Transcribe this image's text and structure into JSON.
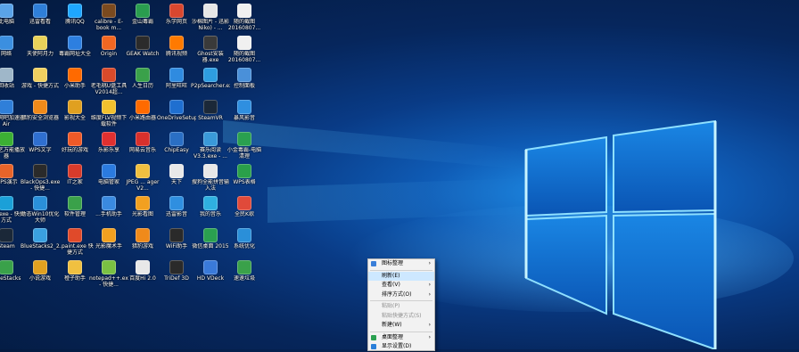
{
  "desktop": {
    "icons": [
      {
        "label": "此电脑",
        "color": "#5aa3e8"
      },
      {
        "label": "迅雷看看",
        "color": "#2f7fd9"
      },
      {
        "label": "腾讯QQ",
        "color": "#1ea7ff"
      },
      {
        "label": "calibre - E-book m...",
        "color": "#7b4a1f"
      },
      {
        "label": "金山毒霸",
        "color": "#2a9d4f"
      },
      {
        "label": "乐学网页",
        "color": "#d9472f"
      },
      {
        "label": "沙棉图片 - 迅影 Niko) - ...",
        "color": "#e6e6e6"
      },
      {
        "label": "随的截图 20160807...",
        "color": "#f0f0f0"
      },
      {
        "label": "网络",
        "color": "#3b8fe0"
      },
      {
        "label": "天使阿月力",
        "color": "#e8d25a"
      },
      {
        "label": "毒霸网址大全",
        "color": "#2d7fe0"
      },
      {
        "label": "Origin",
        "color": "#f26722"
      },
      {
        "label": "GEAK Watch",
        "color": "#2b2b2b"
      },
      {
        "label": "腾讯视频",
        "color": "#ff7a00"
      },
      {
        "label": "Ghost安装器.exe",
        "color": "#3a3a3a"
      },
      {
        "label": "随的截图 20160807...",
        "color": "#f0f0f0"
      },
      {
        "label": "回收站",
        "color": "#9fb7c9"
      },
      {
        "label": "游戏 - 快捷方式",
        "color": "#f0d060"
      },
      {
        "label": "小米助手",
        "color": "#ff6a00"
      },
      {
        "label": "老毛桃U盘工具V2014超...",
        "color": "#d94a2a"
      },
      {
        "label": "人生日历",
        "color": "#3aa14a"
      },
      {
        "label": "阿里旺旺",
        "color": "#2f8be0"
      },
      {
        "label": "P2pSearcher.exe",
        "color": "#2e9de0"
      },
      {
        "label": "控制面板",
        "color": "#4a90d9"
      },
      {
        "label": "迅雷网吧加速器Air",
        "color": "#2f7fd9"
      },
      {
        "label": "猎豹安全浏览器",
        "color": "#f08a1a"
      },
      {
        "label": "影视大全",
        "color": "#e0a020"
      },
      {
        "label": "维度FLV视频下载软件",
        "color": "#f2c12e"
      },
      {
        "label": "小米路由器",
        "color": "#ff6a00"
      },
      {
        "label": "OneDriveSetup.exe",
        "color": "#1f6fd0"
      },
      {
        "label": "SteamVR",
        "color": "#1b2838"
      },
      {
        "label": "暴风影音",
        "color": "#2f8fe0"
      },
      {
        "label": "爱奇艺万能播放器",
        "color": "#3cb034"
      },
      {
        "label": "WPS文字",
        "color": "#2f6fd0"
      },
      {
        "label": "好玩的游戏",
        "color": "#f05a28"
      },
      {
        "label": "乐影乐享",
        "color": "#e03030"
      },
      {
        "label": "网易云音乐",
        "color": "#d8302c"
      },
      {
        "label": "ChipEasy",
        "color": "#2a6fc4"
      },
      {
        "label": "赛乐阅读 V3.3.exe - ...",
        "color": "#3a9ad9"
      },
      {
        "label": "小金毒霸-电脑清理",
        "color": "#2aa050"
      },
      {
        "label": "WPS演示",
        "color": "#e8642a"
      },
      {
        "label": "BlackOps3.exe - 快捷...",
        "color": "#2a2a2a"
      },
      {
        "label": "IT之家",
        "color": "#d83b2b"
      },
      {
        "label": "电脑管家",
        "color": "#2b7be0"
      },
      {
        "label": "JPEG ... ager V2...",
        "color": "#f0c040"
      },
      {
        "label": "天下",
        "color": "#e8e8e8"
      },
      {
        "label": "搜狗全能拼音输入法",
        "color": "#e8e8e8"
      },
      {
        "label": "WPS表格",
        "color": "#2aa04a"
      },
      {
        "label": "Kodiexe - 快捷方式",
        "color": "#1ba0d8"
      },
      {
        "label": "动态Win10优化大师",
        "color": "#2a8fd9"
      },
      {
        "label": "软件管理",
        "color": "#3aa14a"
      },
      {
        "label": "...手机助手",
        "color": "#3a8ae0"
      },
      {
        "label": "光影看图",
        "color": "#f2a020"
      },
      {
        "label": "迅雷影音",
        "color": "#2f8fe0"
      },
      {
        "label": "我的音乐",
        "color": "#2fb0e0"
      },
      {
        "label": "全民K歌",
        "color": "#e04a3a"
      },
      {
        "label": "Steam",
        "color": "#1b2838"
      },
      {
        "label": "BlueStacks2_2.3.35.61...",
        "color": "#3aa0e0"
      },
      {
        "label": "...paint.exe 快捷方式",
        "color": "#e04a2a"
      },
      {
        "label": "光影魔术手",
        "color": "#f2a020"
      },
      {
        "label": "猎豹游戏",
        "color": "#f08a1a"
      },
      {
        "label": "WiFi助手",
        "color": "#2a2a2a"
      },
      {
        "label": "微信桌面 2015",
        "color": "#2aa050"
      },
      {
        "label": "系统优化",
        "color": "#2a8fd9"
      },
      {
        "label": "BlueStacks",
        "color": "#3aa14a"
      },
      {
        "label": "小说游戏",
        "color": "#e0a020"
      },
      {
        "label": "橙子助手",
        "color": "#f0c040"
      },
      {
        "label": "notepad++.exe - 快捷...",
        "color": "#7ac143"
      },
      {
        "label": "百度Hi 2.0",
        "color": "#e8e8e8"
      },
      {
        "label": "TriDef 3D",
        "color": "#2a2a2a"
      },
      {
        "label": "HD VDeck",
        "color": "#3a7ad9"
      },
      {
        "label": "速速垃圾",
        "color": "#3aa14a"
      }
    ]
  },
  "context_menu": {
    "items": [
      {
        "label": "图标整理",
        "arrow": "›",
        "state": "normal",
        "sep_after": true
      },
      {
        "label": "刷新(E)",
        "arrow": "",
        "state": "highlight",
        "sep_after": false
      },
      {
        "label": "查看(V)",
        "arrow": "›",
        "state": "normal",
        "sep_after": false
      },
      {
        "label": "排序方式(O)",
        "arrow": "›",
        "state": "normal",
        "sep_after": true
      },
      {
        "label": "粘贴(P)",
        "arrow": "",
        "state": "disabled",
        "sep_after": false
      },
      {
        "label": "粘贴快捷方式(S)",
        "arrow": "",
        "state": "disabled",
        "sep_after": false
      },
      {
        "label": "新建(W)",
        "arrow": "›",
        "state": "normal",
        "sep_after": true
      },
      {
        "label": "桌面整理",
        "arrow": "›",
        "state": "normal",
        "sep_after": false
      },
      {
        "label": "显示设置(D)",
        "arrow": "",
        "state": "normal",
        "sep_after": false
      }
    ]
  }
}
